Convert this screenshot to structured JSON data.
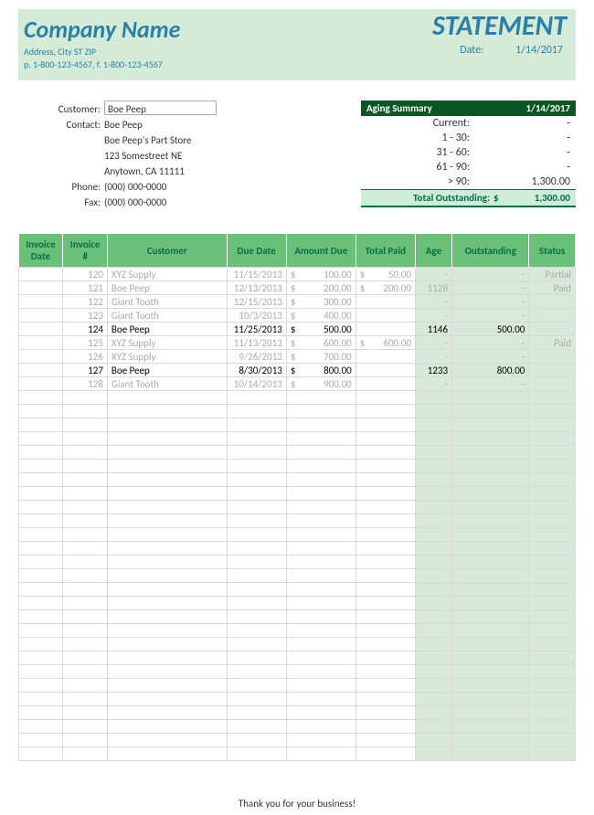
{
  "header": {
    "company_name": "Company Name",
    "address_line1": "Address, City ST ZIP",
    "address_line2": "p. 1-800-123-4567, f. 1-800-123-4567",
    "title": "STATEMENT",
    "date_label": "Date:",
    "date_value": "1/14/2017"
  },
  "customer": {
    "label": "Customer:",
    "name": "Boe Peep",
    "contact_label": "Contact:",
    "contact": "Boe Peep",
    "company": "Boe Peep's Part Store",
    "street": "123 Somestreet NE",
    "citystate": "Anytown, CA 11111",
    "phone_label": "Phone:",
    "phone": "(000) 000-0000",
    "fax_label": "Fax:",
    "fax": "(000) 000-0000"
  },
  "aging": {
    "title": "Aging Summary",
    "date": "1/14/2017",
    "rows": [
      {
        "k": "Current:",
        "v": "-"
      },
      {
        "k": "1 - 30:",
        "v": "-"
      },
      {
        "k": "31 - 60:",
        "v": "-"
      },
      {
        "k": "61 - 90:",
        "v": "-"
      },
      {
        "k": "> 90:",
        "v": "1,300.00"
      }
    ],
    "total_label": "Total Outstanding:",
    "total_cur": "$",
    "total_val": "1,300.00"
  },
  "cols": {
    "date": "Invoice Date",
    "inv": "Invoice #",
    "cust": "Customer",
    "due": "Due Date",
    "amt": "Amount Due",
    "paid": "Total Paid",
    "age": "Age",
    "out": "Outstanding",
    "stat": "Status"
  },
  "rows": [
    {
      "dim": true,
      "inv": "120",
      "cust": "XYZ Supply",
      "due": "11/15/2013",
      "cur": "$",
      "amt": "100.00",
      "pcur": "$",
      "paid": "50.00",
      "age": "",
      "out": "",
      "stat": "Partial"
    },
    {
      "dim": true,
      "inv": "121",
      "cust": "Boe Peep",
      "due": "12/13/2013",
      "cur": "$",
      "amt": "200.00",
      "pcur": "$",
      "paid": "200.00",
      "age": "1128",
      "out": "-",
      "stat": "Paid"
    },
    {
      "dim": true,
      "inv": "122",
      "cust": "Giant Tooth",
      "due": "12/15/2013",
      "cur": "$",
      "amt": "300.00",
      "pcur": "",
      "paid": "",
      "age": "",
      "out": "",
      "stat": ""
    },
    {
      "dim": true,
      "inv": "123",
      "cust": "Giant Tooth",
      "due": "10/3/2013",
      "cur": "$",
      "amt": "400.00",
      "pcur": "",
      "paid": "",
      "age": "",
      "out": "",
      "stat": ""
    },
    {
      "dim": false,
      "inv": "124",
      "cust": "Boe Peep",
      "dueRed": true,
      "due": "11/25/2013",
      "cur": "$",
      "amt": "500.00",
      "pcur": "",
      "paid": "",
      "age": "1146",
      "out": "500.00",
      "stat": ""
    },
    {
      "dim": true,
      "inv": "125",
      "cust": "XYZ Supply",
      "due": "11/13/2013",
      "cur": "$",
      "amt": "600.00",
      "pcur": "$",
      "paid": "600.00",
      "age": "",
      "out": "-",
      "stat": "Paid"
    },
    {
      "dim": true,
      "inv": "126",
      "cust": "XYZ Supply",
      "due": "9/26/2013",
      "cur": "$",
      "amt": "700.00",
      "pcur": "",
      "paid": "",
      "age": "",
      "out": "-",
      "stat": ""
    },
    {
      "dim": false,
      "inv": "127",
      "cust": "Boe Peep",
      "dueRed": true,
      "due": "8/30/2013",
      "cur": "$",
      "amt": "800.00",
      "pcur": "",
      "paid": "",
      "age": "1233",
      "out": "800.00",
      "stat": ""
    },
    {
      "dim": true,
      "inv": "128",
      "cust": "Giant Tooth",
      "due": "10/14/2013",
      "cur": "$",
      "amt": "900.00",
      "pcur": "",
      "paid": "",
      "age": "",
      "out": "-",
      "stat": ""
    }
  ],
  "blank_rows": 27,
  "dash": "-",
  "footer": "Thank you for your business!"
}
